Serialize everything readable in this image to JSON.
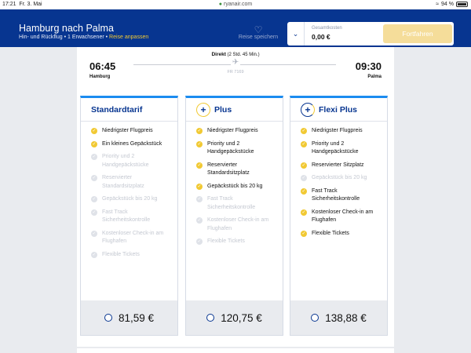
{
  "status_bar": {
    "time": "17:21",
    "date": "Fr. 3. Mai",
    "url": "ryanair.com",
    "battery": "94 %"
  },
  "header": {
    "title": "Hamburg nach Palma",
    "subtitle": "Hin- und Rückflug • 1 Erwachsener •",
    "adjust_link": "Reise anpassen",
    "save_label": "Reise speichern",
    "total_label": "Gesamtkosten",
    "total_value": "0,00 €",
    "continue_label": "Fortfahren"
  },
  "flight": {
    "direct_label": "Direkt",
    "duration": "(2 Std. 45 Min.)",
    "flight_number": "FR 7169",
    "departure_time": "06:45",
    "departure_city": "Hamburg",
    "arrival_time": "09:30",
    "arrival_city": "Palma"
  },
  "fares": [
    {
      "name": "Standardtarif",
      "price": "81,59 €",
      "features": [
        {
          "text": "Niedrigster Flugpreis",
          "included": true
        },
        {
          "text": "Ein kleines Gepäckstück",
          "included": true
        },
        {
          "text": "Priority und 2 Handgepäckstücke",
          "included": false
        },
        {
          "text": "Reservierter Standardsitzplatz",
          "included": false
        },
        {
          "text": "Gepäckstück bis 20 kg",
          "included": false
        },
        {
          "text": "Fast Track Sicherheitskontrolle",
          "included": false
        },
        {
          "text": "Kostenloser Check-in am Flughafen",
          "included": false
        },
        {
          "text": "Flexible Tickets",
          "included": false
        }
      ]
    },
    {
      "name": "Plus",
      "icon": "plus-icon",
      "price": "120,75 €",
      "features": [
        {
          "text": "Niedrigster Flugpreis",
          "included": true
        },
        {
          "text": "Priority und 2 Handgepäckstücke",
          "included": true
        },
        {
          "text": "Reservierter Standardsitzplatz",
          "included": true
        },
        {
          "text": "Gepäckstück bis 20 kg",
          "included": true
        },
        {
          "text": "Fast Track Sicherheitskontrolle",
          "included": false
        },
        {
          "text": "Kostenloser Check-in am Flughafen",
          "included": false
        },
        {
          "text": "Flexible Tickets",
          "included": false
        }
      ]
    },
    {
      "name": "Flexi Plus",
      "icon": "flexi-plus-icon",
      "price": "138,88 €",
      "features": [
        {
          "text": "Niedrigster Flugpreis",
          "included": true
        },
        {
          "text": "Priority und 2 Handgepäckstücke",
          "included": true
        },
        {
          "text": "Reservierter Sitzplatz",
          "included": true
        },
        {
          "text": "Gepäckstück bis 20 kg",
          "included": false
        },
        {
          "text": "Fast Track Sicherheitskontrolle",
          "included": true
        },
        {
          "text": "Kostenloser Check-in am Flughafen",
          "included": true
        },
        {
          "text": "Flexible Tickets",
          "included": true
        }
      ]
    }
  ],
  "colors": {
    "brand_blue": "#073590",
    "accent_yellow": "#f1c933",
    "card_top_border": "#1b8cf0"
  }
}
